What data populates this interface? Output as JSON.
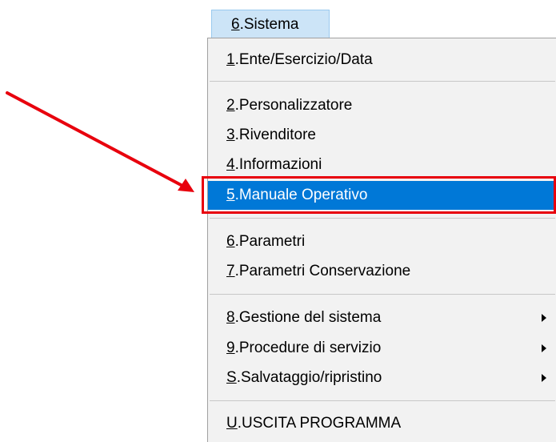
{
  "menu": {
    "header": {
      "key": "6",
      "rest": ".Sistema"
    },
    "items": [
      {
        "key": "1",
        "rest": ".Ente/Esercizio/Data"
      },
      {
        "key": "2",
        "rest": ".Personalizzatore"
      },
      {
        "key": "3",
        "rest": ".Rivenditore"
      },
      {
        "key": "4",
        "rest": ".Informazioni"
      },
      {
        "key": "5",
        "rest": ".Manuale Operativo"
      },
      {
        "key": "6",
        "rest": ".Parametri"
      },
      {
        "key": "7",
        "rest": ".Parametri Conservazione"
      },
      {
        "key": "8",
        "rest": ".Gestione del sistema"
      },
      {
        "key": "9",
        "rest": ".Procedure di servizio"
      },
      {
        "key": "S",
        "rest": ".Salvataggio/ripristino"
      },
      {
        "key": "U",
        "rest": ".USCITA PROGRAMMA"
      }
    ]
  },
  "colors": {
    "highlight": "#0078d7",
    "menu_bg": "#f2f2f2",
    "header_bg": "#cce4f7",
    "annotation": "#e8000d"
  },
  "icons": {
    "submenu": "submenu-arrow-icon",
    "annotation": "red-arrow-icon"
  }
}
